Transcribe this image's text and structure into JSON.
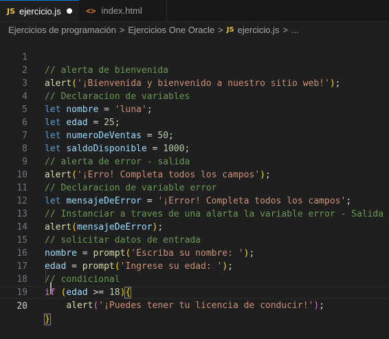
{
  "tabs": [
    {
      "badge": "JS",
      "label": "ejercicio.js"
    },
    {
      "badge": "<>",
      "label": "index.html"
    }
  ],
  "breadcrumb": {
    "items": [
      "Ejercicios de programación",
      "Ejercicios One Oracle",
      "ejercicio.js",
      "..."
    ],
    "separator": ">",
    "js_badge": "JS"
  },
  "lines": {
    "l1": {
      "n": "1",
      "t": [
        "// alerta de bienvenida"
      ]
    },
    "l2": {
      "n": "2",
      "t": [
        "alert",
        "(",
        "'¡Bienvenida y bienvenido a nuestro sitio web!'",
        ")",
        ";"
      ]
    },
    "l3": {
      "n": "3",
      "t": [
        "// Declaracion de variables"
      ]
    },
    "l4": {
      "n": "4",
      "t": [
        "let",
        " ",
        "nombre",
        " = ",
        "'luna'",
        ";"
      ]
    },
    "l5": {
      "n": "5",
      "t": [
        "let",
        " ",
        "edad",
        " = ",
        "25",
        ";"
      ]
    },
    "l6": {
      "n": "6",
      "t": [
        "let",
        " ",
        "numeroDeVentas",
        " = ",
        "50",
        ";"
      ]
    },
    "l7": {
      "n": "7",
      "t": [
        "let",
        " ",
        "saldoDisponible",
        " = ",
        "1000",
        ";"
      ]
    },
    "l8": {
      "n": "8",
      "t": [
        "// alerta de error - salida"
      ]
    },
    "l9": {
      "n": "9",
      "t": [
        "alert",
        "(",
        "'¡Erro! Completa todos los campos'",
        ")",
        ";"
      ]
    },
    "l10": {
      "n": "10",
      "t": [
        "// Declaracion de variable error"
      ]
    },
    "l11": {
      "n": "11",
      "t": [
        "let",
        " ",
        "mensajeDeError",
        " = ",
        "'¡Error! Completa todos los campos'",
        ";"
      ]
    },
    "l12": {
      "n": "12",
      "t": [
        "// Instanciar a traves de una alarta la variable error - Salida"
      ]
    },
    "l13": {
      "n": "13",
      "t": [
        "alert",
        "(",
        "mensajeDeError",
        ")",
        ";"
      ]
    },
    "l14": {
      "n": "14",
      "t": [
        "// solicitar datos de entrada"
      ]
    },
    "l15": {
      "n": "15",
      "t": [
        "nombre",
        " = ",
        "prompt",
        "(",
        "'Escriba su nombre: '",
        ")",
        ";"
      ]
    },
    "l16": {
      "n": "16",
      "t": [
        "edad",
        " = ",
        "prompt",
        "(",
        "'Ingrese su edad: '",
        ")",
        ";"
      ]
    },
    "l17": {
      "n": "17",
      "t": [
        "// condicional"
      ]
    },
    "l18": {
      "n": "18",
      "t": [
        "if",
        " ",
        "(",
        "edad",
        " >= ",
        "18",
        ")",
        "{"
      ]
    },
    "l19": {
      "n": "19",
      "t": [
        "    ",
        "alert",
        "(",
        "'¡Puedes tener tu licencia de conducir!'",
        ")",
        ";"
      ]
    },
    "l20": {
      "n": "20",
      "t": [
        "}"
      ]
    }
  },
  "colors": {
    "background": "#1f1f1f",
    "comment": "#6a9955",
    "function": "#dcdcaa",
    "string": "#ce9178",
    "keyword": "#569cd6",
    "variable": "#9cdcfe",
    "number": "#b5cea8",
    "active_tab_accent": "#0078d4"
  }
}
